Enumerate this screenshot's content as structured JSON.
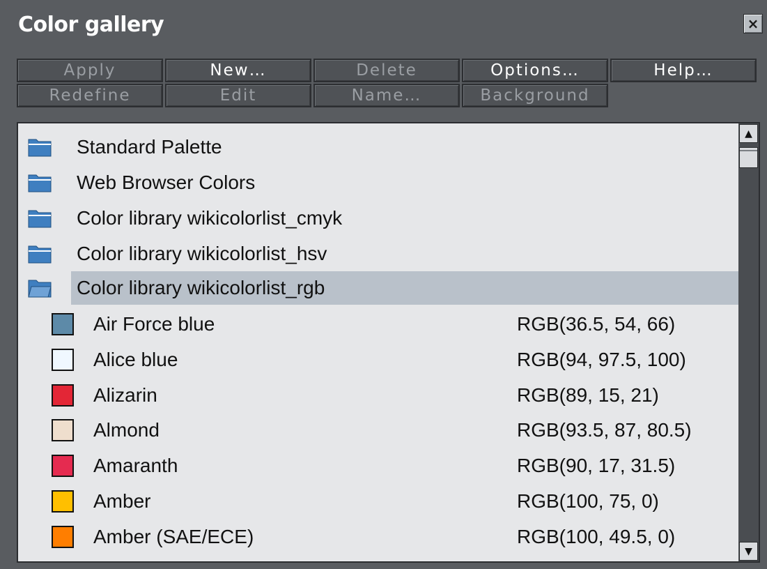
{
  "window": {
    "title": "Color gallery",
    "close_glyph": "×"
  },
  "toolbar": {
    "apply": "Apply",
    "new": "New…",
    "delete": "Delete",
    "options": "Options…",
    "help": "Help…",
    "redefine": "Redefine",
    "edit": "Edit",
    "name": "Name…",
    "background": "Background"
  },
  "folders": [
    {
      "label": "Standard Palette",
      "icon": "folder-icon"
    },
    {
      "label": "Web Browser Colors",
      "icon": "folder-icon"
    },
    {
      "label": "Color library wikicolorlist_cmyk",
      "icon": "folder-icon"
    },
    {
      "label": "Color library wikicolorlist_hsv",
      "icon": "folder-icon"
    },
    {
      "label": "Color library wikicolorlist_rgb",
      "icon": "open-folder-icon",
      "selected": true
    }
  ],
  "colors": [
    {
      "name": "Air Force blue",
      "value": "RGB(36.5, 54, 66)",
      "swatch": "#5d8aa8"
    },
    {
      "name": "Alice blue",
      "value": "RGB(94, 97.5, 100)",
      "swatch": "#f0f8ff"
    },
    {
      "name": "Alizarin",
      "value": "RGB(89, 15, 21)",
      "swatch": "#e32636"
    },
    {
      "name": "Almond",
      "value": "RGB(93.5, 87, 80.5)",
      "swatch": "#efdecd"
    },
    {
      "name": "Amaranth",
      "value": "RGB(90, 17, 31.5)",
      "swatch": "#e52b50"
    },
    {
      "name": "Amber",
      "value": "RGB(100, 75, 0)",
      "swatch": "#ffbf00"
    },
    {
      "name": "Amber (SAE/ECE)",
      "value": "RGB(100, 49.5, 0)",
      "swatch": "#ff7e00"
    }
  ],
  "scrollbar": {
    "up_glyph": "▲",
    "down_glyph": "▼"
  },
  "colors_theme": {
    "panel_bg": "#595c60",
    "list_bg": "#e6e7e9",
    "selected_row": "#b9c1ca",
    "folder_blue": "#3f7fc0"
  }
}
